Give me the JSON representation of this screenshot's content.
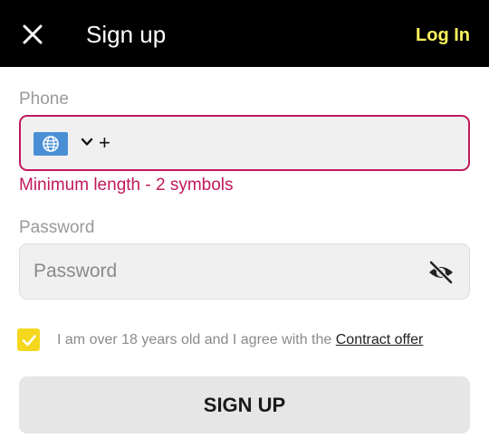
{
  "header": {
    "title": "Sign up",
    "login_label": "Log In",
    "login_color": "#fff35c",
    "close_icon": "close-icon"
  },
  "phone": {
    "label": "Phone",
    "prefix": "+",
    "value": "",
    "error": "Minimum length - 2 symbols",
    "country_icon": "globe-icon",
    "border_color": "#c2185b"
  },
  "password": {
    "label": "Password",
    "placeholder": "Password",
    "value": "",
    "toggle_icon": "eye-slash-icon"
  },
  "agreement": {
    "checked": true,
    "text": "I am over 18 years old and I agree with the ",
    "link_label": "Contract offer",
    "checkbox_color": "#f5d81e"
  },
  "submit": {
    "label": "SIGN UP"
  }
}
